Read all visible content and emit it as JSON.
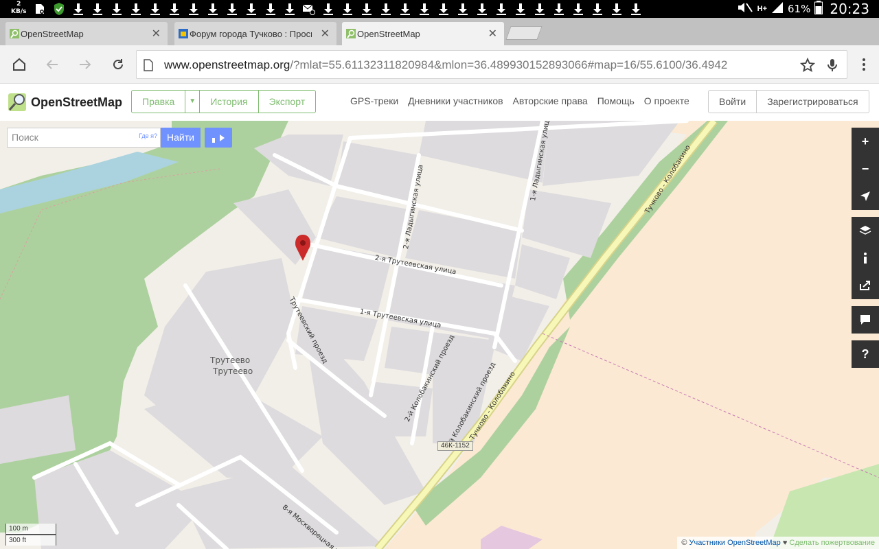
{
  "statusbar": {
    "speed_value": "2",
    "speed_unit": "KB/s",
    "battery_percent": "61%",
    "time": "20:23",
    "network": "H+"
  },
  "tabs": [
    {
      "title": "OpenStreetMap",
      "close": "✕"
    },
    {
      "title": "Форум города Тучково : Просм",
      "close": "✕"
    },
    {
      "title": "OpenStreetMap",
      "close": "✕"
    }
  ],
  "omnibox": {
    "domain": "www.openstreetmap.org",
    "path": "/?mlat=55.61132311820984&mlon=36.489930152893066#map=16/55.6100/36.4942"
  },
  "osm": {
    "title": "OpenStreetMap",
    "edit": "Правка",
    "history": "История",
    "export": "Экспорт",
    "nav": [
      "GPS-треки",
      "Дневники участников",
      "Авторские права",
      "Помощь",
      "О проекте"
    ],
    "login": "Войти",
    "signup": "Зарегистрироваться"
  },
  "search": {
    "placeholder": "Поиск",
    "where": "Где я?",
    "go": "Найти"
  },
  "map": {
    "place_name_1": "Трутеево",
    "place_name_2": "Трутеево",
    "streets": {
      "s1": "2-я Трутеевская улица",
      "s2": "1-я Трутеевская улица",
      "s3": "Трутеевский проезд",
      "s4": "2-я Ладыгинская улица",
      "s5": "1-я Ладыгинская улица",
      "s6": "2-й Колобакинский проезд",
      "s7": "1-й Колобакинский проезд",
      "s8": "Тучково - Колобакино",
      "s9": "Тучково - Колобакино",
      "s10": "8-я Москворецкая у"
    },
    "road_ref": "46К-1152",
    "scale_m": "100 m",
    "scale_ft": "300 ft",
    "controls": [
      "+",
      "−"
    ],
    "colors": {
      "residential": "#dddbdd",
      "forest": "#add19e",
      "farmland": "#f8e7d0",
      "water": "#aad3df",
      "road": "#f7f7b8"
    }
  },
  "attribution": {
    "prefix": "©",
    "link": "Участники OpenStreetMap",
    "heart": "♥",
    "donate": "Сделать пожертвование"
  }
}
